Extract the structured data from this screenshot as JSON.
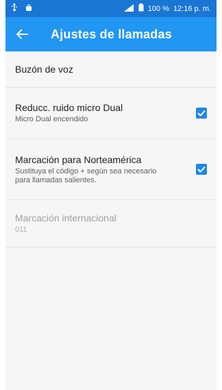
{
  "status_bar": {
    "battery": "100 %",
    "time": "12:16 p. m.",
    "icons": [
      "usb-icon",
      "android-icon",
      "signal-icon",
      "battery-icon"
    ]
  },
  "app_bar": {
    "title": "Ajustes de llamadas",
    "back_icon": "back-arrow-icon",
    "color": "#2196f3"
  },
  "settings": [
    {
      "title": "Buzón de voz",
      "subtitle": "",
      "checked": null,
      "enabled": true
    },
    {
      "title": "Reducc. ruido micro Dual",
      "subtitle": "Micro Dual encendido",
      "checked": true,
      "enabled": true
    },
    {
      "title": "Marcación para Norteamérica",
      "subtitle": "Sustituya el código + según sea necesario para llamadas salientes.",
      "checked": true,
      "enabled": true
    },
    {
      "title": "Marcación internacional",
      "subtitle": "011",
      "checked": null,
      "enabled": false
    }
  ],
  "accent_color": "#1e88e5"
}
